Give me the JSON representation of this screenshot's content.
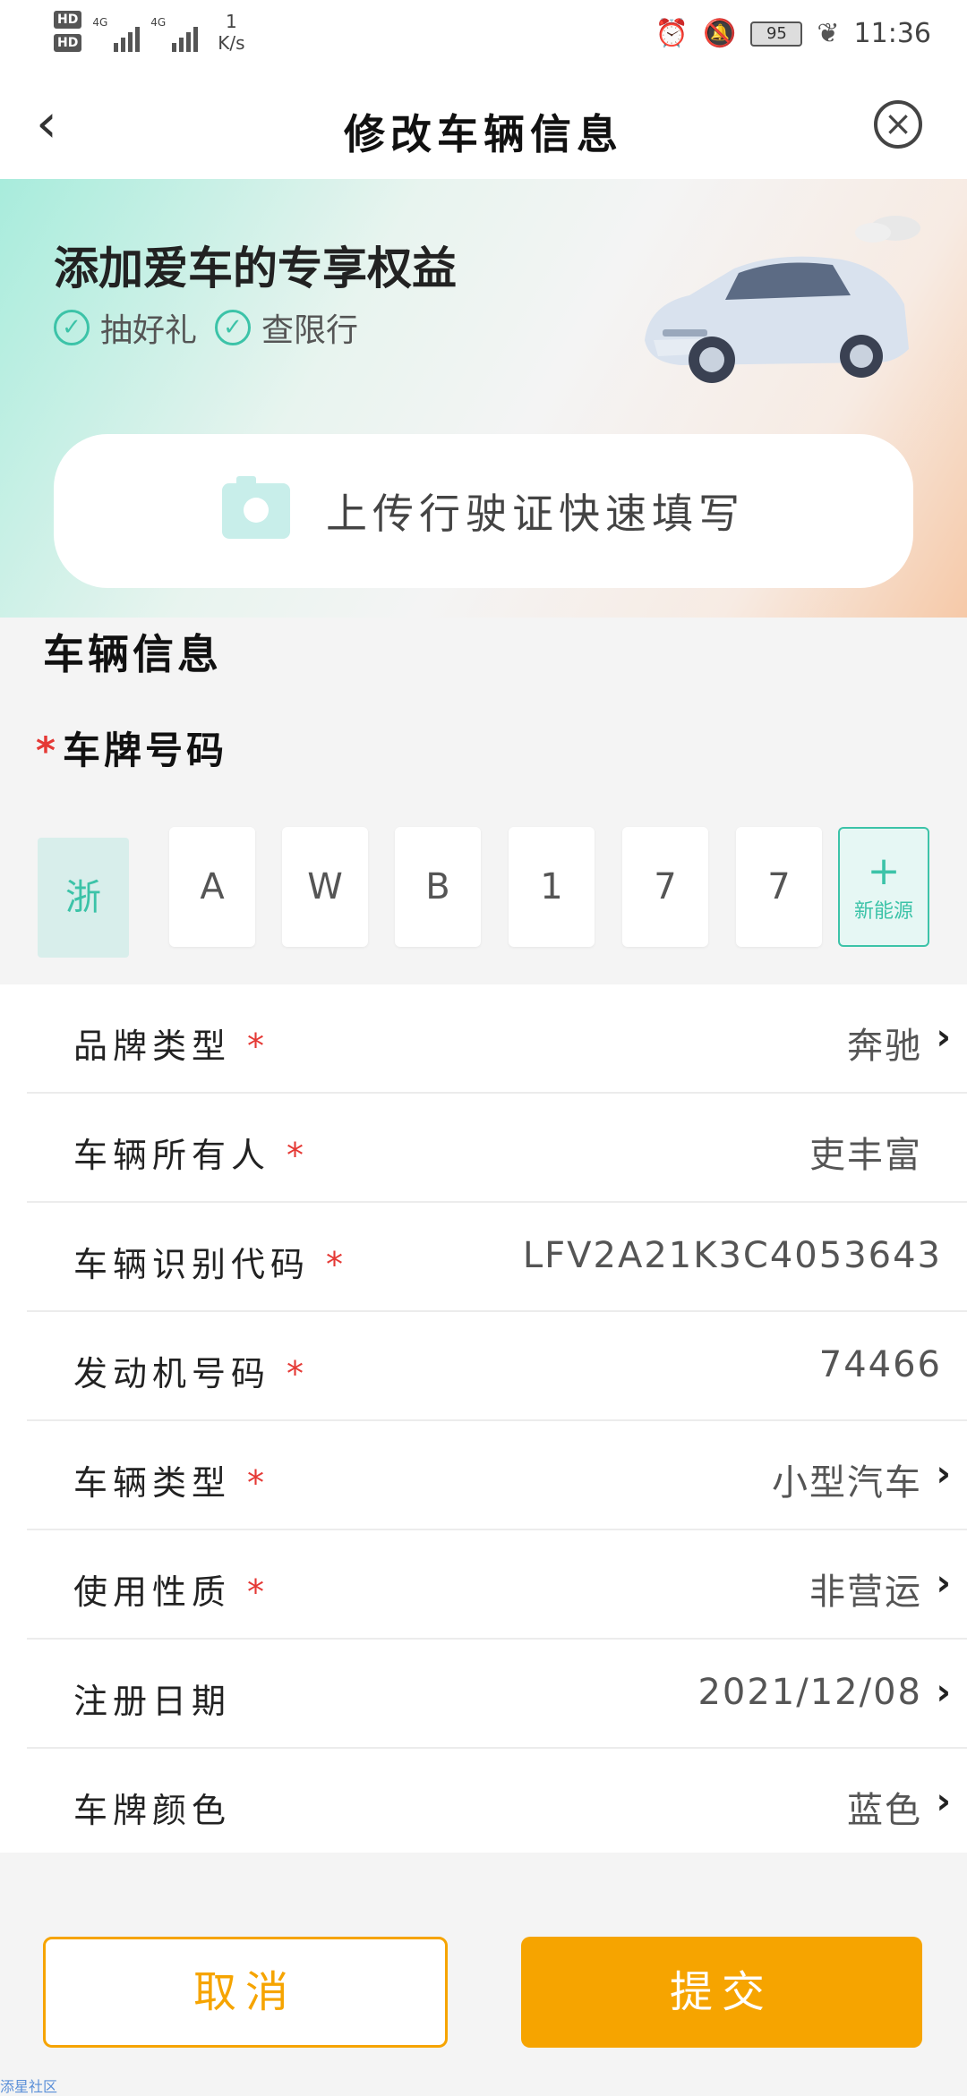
{
  "status_bar": {
    "hd1": "HD",
    "hd2": "HD",
    "net1": "4G",
    "net2": "4G",
    "speed_value": "1",
    "speed_unit": "K/s",
    "battery": "95",
    "time": "11:36"
  },
  "header": {
    "title": "修改车辆信息"
  },
  "banner": {
    "title": "添加爱车的专享权益",
    "perks": [
      "抽好礼",
      "查限行"
    ]
  },
  "upload": {
    "label": "上传行驶证快速填写"
  },
  "section_title": "车辆信息",
  "plate": {
    "required_mark": "*",
    "title": "车牌号码",
    "province": "浙",
    "chars": [
      "A",
      "W",
      "B",
      "1",
      "7",
      "7"
    ],
    "new_energy_plus": "+",
    "new_energy_label": "新能源"
  },
  "form": {
    "rows": [
      {
        "label": "品牌类型",
        "required": "*",
        "value": "奔驰",
        "chevron": "›"
      },
      {
        "label": "车辆所有人",
        "required": "*",
        "value": "吏丰富",
        "chevron": ""
      },
      {
        "label": "车辆识别代码",
        "required": "*",
        "value": "LFV2A21K3C4053643",
        "chevron": ""
      },
      {
        "label": "发动机号码",
        "required": "*",
        "value": "74466",
        "chevron": ""
      },
      {
        "label": "车辆类型",
        "required": "*",
        "value": "小型汽车",
        "chevron": "›"
      },
      {
        "label": "使用性质",
        "required": "*",
        "value": "非营运",
        "chevron": "›"
      },
      {
        "label": "注册日期",
        "required": "",
        "value": "2021/12/08",
        "chevron": "›"
      },
      {
        "label": "车牌颜色",
        "required": "",
        "value": "蓝色",
        "chevron": "›"
      }
    ]
  },
  "buttons": {
    "cancel": "取消",
    "submit": "提交"
  },
  "watermark": "添星社区",
  "colors": {
    "accent_teal": "#3cc3a8",
    "accent_orange": "#f6a400",
    "required_red": "#e53935"
  }
}
